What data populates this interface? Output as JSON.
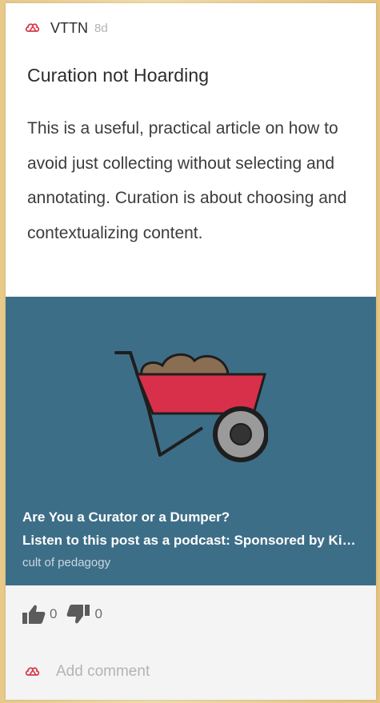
{
  "post": {
    "author": "VTTN",
    "age": "8d",
    "title": "Curation not Hoarding",
    "body": "This is a useful, practical article on how to avoid just collecting without selecting and annotating. Curation is about choosing and contextualizing content."
  },
  "attachment": {
    "title": "Are You a Curator or a Dumper?",
    "description": "Listen to this post as a podcast: Sponsored by Kiddom. Want to help your students think critically",
    "source": "cult of pedagogy",
    "image_icon": "wheelbarrow-icon",
    "background_color": "#3d6e87"
  },
  "reactions": {
    "like_count": "0",
    "dislike_count": "0",
    "like_icon": "thumbs-up-icon",
    "dislike_icon": "thumbs-down-icon"
  },
  "comment": {
    "placeholder": "Add comment",
    "icon": "padlet-logo-icon"
  },
  "colors": {
    "accent": "#d93a4b",
    "card_background": "#ffffff",
    "footer_background": "#f4f4f4"
  }
}
